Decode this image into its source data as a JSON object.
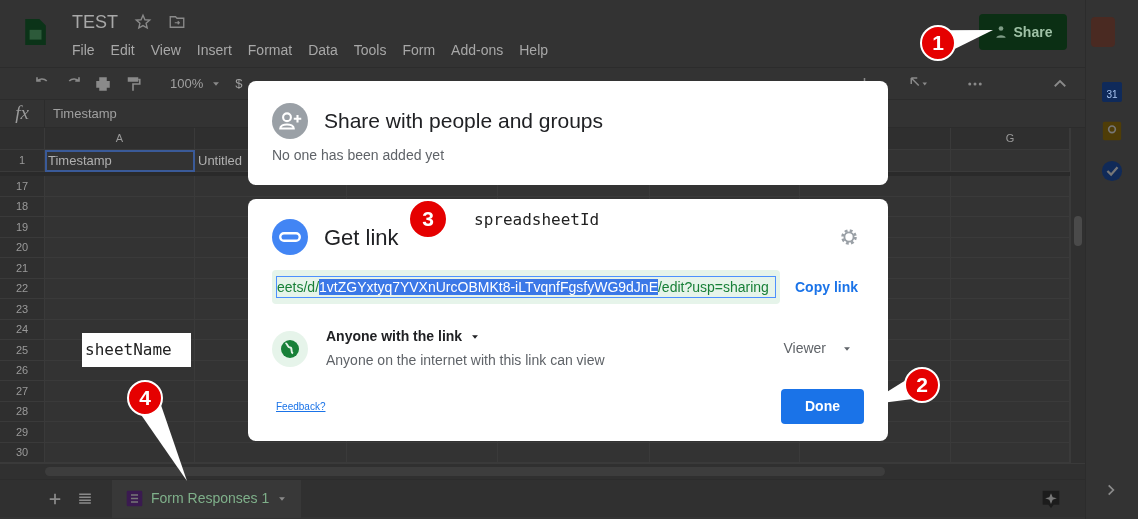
{
  "app": {
    "title": "TEST",
    "menu": [
      "File",
      "Edit",
      "View",
      "Insert",
      "Format",
      "Data",
      "Tools",
      "Form",
      "Add-ons",
      "Help"
    ],
    "share_button": "Share"
  },
  "toolbar": {
    "zoom": "100%",
    "currency": "$"
  },
  "formula_bar": {
    "fx": "fx",
    "value": "Timestamp"
  },
  "grid": {
    "column_headers": [
      "A",
      "G"
    ],
    "rows": [
      {
        "number": "1",
        "cells": [
          {
            "text": "Timestamp",
            "selected": true
          },
          {
            "text": "Untitled",
            "selected": false
          }
        ]
      },
      {
        "number": "17"
      },
      {
        "number": "18"
      },
      {
        "number": "19"
      },
      {
        "number": "20"
      },
      {
        "number": "21"
      },
      {
        "number": "22"
      },
      {
        "number": "23"
      },
      {
        "number": "24"
      },
      {
        "number": "25"
      },
      {
        "number": "26"
      },
      {
        "number": "27"
      },
      {
        "number": "28"
      },
      {
        "number": "29"
      },
      {
        "number": "30"
      }
    ]
  },
  "sheet_tabs": [
    {
      "label": "Form Responses 1",
      "selected": true
    }
  ],
  "side_panel": {
    "calendar_day": "31"
  },
  "share_dialog": {
    "title": "Share with people and groups",
    "subtitle": "No one has been added yet"
  },
  "link_dialog": {
    "title": "Get link",
    "link_prefix": "eets/d/",
    "link_id": "1vtZGYxtyq7YVXnUrcOBMKt8-iLTvqnfFgsfyWG9dJnE",
    "link_suffix": "/edit?usp=sharing",
    "copy_link": "Copy link",
    "access": "Anyone with the link",
    "access_description": "Anyone on the internet with this link can view",
    "role": "Viewer",
    "feedback": "Feedback?",
    "done": "Done"
  },
  "annotations": {
    "callouts": [
      {
        "number": "1",
        "kind": "pointer"
      },
      {
        "number": "2",
        "kind": "pointer"
      },
      {
        "number": "3",
        "kind": "plain"
      },
      {
        "number": "4",
        "kind": "pointer"
      }
    ],
    "labels": [
      {
        "text": "spreadsheetId",
        "kind": "bare"
      },
      {
        "text": "sheetName",
        "kind": "boxed"
      }
    ]
  }
}
